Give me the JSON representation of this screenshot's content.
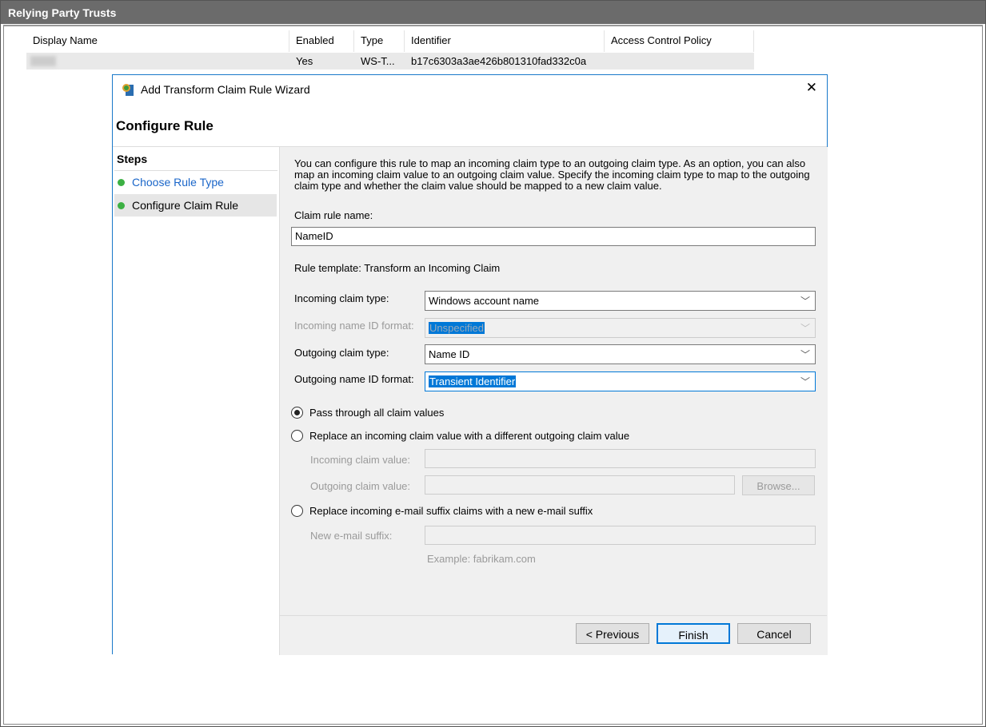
{
  "app": {
    "title": "Relying Party Trusts"
  },
  "table": {
    "columns": [
      "Display Name",
      "Enabled",
      "Type",
      "Identifier",
      "Access Control Policy"
    ],
    "row": {
      "enabled": "Yes",
      "type": "WS-T...",
      "identifier": "b17c6303a3ae426b801310fad332c0a",
      "policy": ""
    }
  },
  "dialog": {
    "title": "Add Transform Claim Rule Wizard",
    "heading": "Configure Rule",
    "close": "✕",
    "steps_title": "Steps",
    "steps": [
      "Choose Rule Type",
      "Configure Claim Rule"
    ],
    "description": "You can configure this rule to map an incoming claim type to an outgoing claim type. As an option, you can also map an incoming claim value to an outgoing claim value. Specify the incoming claim type to map to the outgoing claim type and whether the claim value should be mapped to a new claim value.",
    "rule_name_label": "Claim rule name:",
    "rule_name": "NameID",
    "template": "Rule template: Transform an Incoming Claim",
    "incoming_type_label": "Incoming claim type:",
    "incoming_type": "Windows account name",
    "incoming_format_label": "Incoming name ID format:",
    "incoming_format": "Unspecified",
    "outgoing_type_label": "Outgoing claim type:",
    "outgoing_type": "Name ID",
    "outgoing_format_label": "Outgoing name ID format:",
    "outgoing_format": "Transient Identifier",
    "radio1": "Pass through all claim values",
    "radio2": "Replace an incoming claim value with a different outgoing claim value",
    "incoming_value_label": "Incoming claim value:",
    "outgoing_value_label": "Outgoing claim value:",
    "browse": "Browse...",
    "radio3": "Replace incoming e-mail suffix claims with a new e-mail suffix",
    "suffix_label": "New e-mail suffix:",
    "example": "Example: fabrikam.com",
    "previous": "< Previous",
    "finish": "Finish",
    "cancel": "Cancel"
  }
}
